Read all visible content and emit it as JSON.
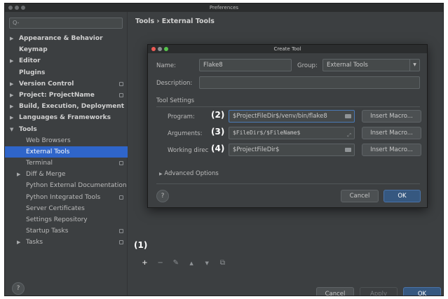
{
  "window": {
    "title": "Preferences"
  },
  "sidebar": {
    "search_placeholder": "Q-",
    "items": [
      {
        "label": "Appearance & Behavior"
      },
      {
        "label": "Keymap"
      },
      {
        "label": "Editor"
      },
      {
        "label": "Plugins"
      },
      {
        "label": "Version Control"
      },
      {
        "label": "Project: ProjectName"
      },
      {
        "label": "Build, Execution, Deployment"
      },
      {
        "label": "Languages & Frameworks"
      },
      {
        "label": "Tools"
      },
      {
        "label": "Web Browsers"
      },
      {
        "label": "External Tools"
      },
      {
        "label": "Terminal"
      },
      {
        "label": "Diff & Merge"
      },
      {
        "label": "Python External Documentation"
      },
      {
        "label": "Python Integrated Tools"
      },
      {
        "label": "Server Certificates"
      },
      {
        "label": "Settings Repository"
      },
      {
        "label": "Startup Tasks"
      },
      {
        "label": "Tasks"
      }
    ]
  },
  "main": {
    "breadcrumb": "Tools › External Tools",
    "toolbar": {
      "add": "+",
      "remove": "−",
      "edit": "✎",
      "up": "▲",
      "down": "▼",
      "copy": "⧉"
    }
  },
  "dialog": {
    "title": "Create Tool",
    "name_label": "Name:",
    "name_value": "Flake8",
    "group_label": "Group:",
    "group_value": "External Tools",
    "description_label": "Description:",
    "description_value": "",
    "tool_settings_label": "Tool Settings",
    "program_label": "Program:",
    "program_value": "$ProjectFileDir$/venv/bin/flake8",
    "arguments_label": "Arguments:",
    "arguments_value": "$FileDir$/$FileName$",
    "working_dir_label": "Working direc",
    "working_dir_value": "$ProjectFileDir$",
    "insert_macro": "Insert Macro...",
    "advanced_options": "Advanced Options",
    "help": "?",
    "cancel": "Cancel",
    "ok": "OK"
  },
  "annotations": {
    "a1": "(1)",
    "a2": "(2)",
    "a3": "(3)",
    "a4": "(4)"
  },
  "footer": {
    "help": "?",
    "cancel": "Cancel",
    "apply": "Apply",
    "ok": "OK"
  }
}
